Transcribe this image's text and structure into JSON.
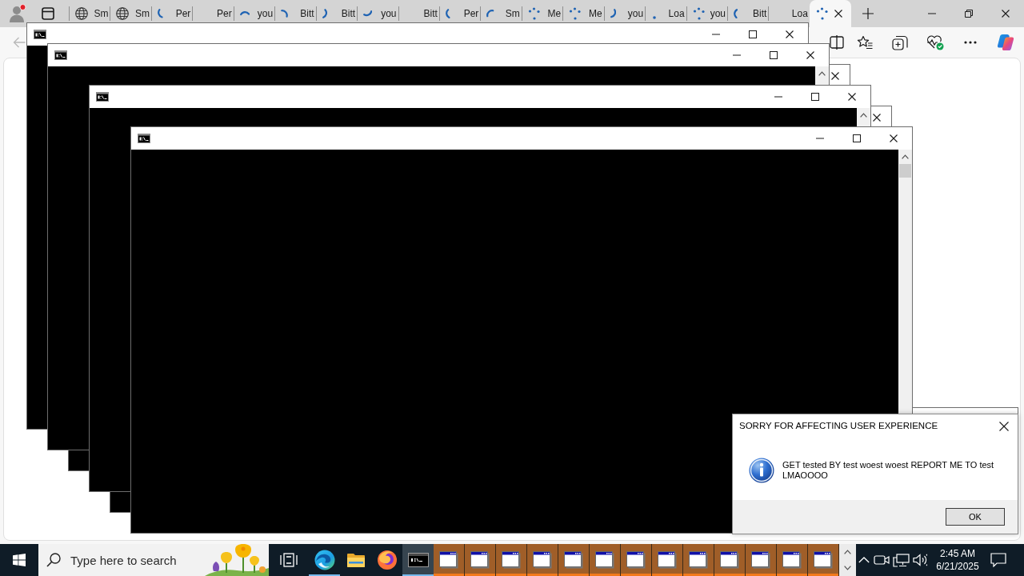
{
  "browser": {
    "tabs": [
      {
        "label": "Sm",
        "kind": "globe",
        "selected": false
      },
      {
        "label": "Sm",
        "kind": "globe",
        "selected": false
      },
      {
        "label": "Per",
        "kind": "spinner",
        "selected": false
      },
      {
        "label": "Per",
        "kind": "plain",
        "selected": false
      },
      {
        "label": "you",
        "kind": "spinner",
        "selected": false
      },
      {
        "label": "Bitt",
        "kind": "spinner",
        "selected": false
      },
      {
        "label": "Bitt",
        "kind": "spinner",
        "selected": false
      },
      {
        "label": "you",
        "kind": "spinner",
        "selected": false
      },
      {
        "label": "Bitt",
        "kind": "plain",
        "selected": false
      },
      {
        "label": "Per",
        "kind": "spinner",
        "selected": false
      },
      {
        "label": "Sm",
        "kind": "spinner",
        "selected": false
      },
      {
        "label": "Me",
        "kind": "dots",
        "selected": false
      },
      {
        "label": "Me",
        "kind": "dots",
        "selected": false
      },
      {
        "label": "you",
        "kind": "spinner",
        "selected": false
      },
      {
        "label": "Loa",
        "kind": "dot",
        "selected": false
      },
      {
        "label": "you",
        "kind": "dots",
        "selected": false
      },
      {
        "label": "Bitt",
        "kind": "spinner",
        "selected": false
      },
      {
        "label": "Loa",
        "kind": "plain",
        "selected": false
      },
      {
        "kind": "dots",
        "selected": true
      }
    ],
    "back": {
      "disabled": true
    }
  },
  "windows": [
    {
      "kind": "console"
    },
    {
      "kind": "console"
    },
    {
      "kind": "console"
    },
    {
      "kind": "console"
    },
    {
      "kind": "console"
    },
    {
      "kind": "console"
    },
    {
      "kind": "frame"
    }
  ],
  "dialog": {
    "title": "SORRY FOR AFFECTING USER EXPERIENCE",
    "message": "GET tested BY test woest woest REPORT ME TO test LMAOOOO",
    "button": "OK"
  },
  "taskbar": {
    "search": {
      "placeholder": "Type here to search"
    },
    "apps": [
      {
        "kind": "browser",
        "selected": false,
        "running": true
      },
      {
        "kind": "folder",
        "selected": false,
        "running": false
      },
      {
        "kind": "fox",
        "selected": false,
        "running": false
      },
      {
        "kind": "console",
        "selected": true,
        "running": true
      }
    ],
    "windows": [
      {
        "flashing": true
      },
      {
        "flashing": true
      },
      {
        "flashing": true
      },
      {
        "flashing": true
      },
      {
        "flashing": true
      },
      {
        "flashing": true
      },
      {
        "flashing": true
      },
      {
        "flashing": true
      },
      {
        "flashing": true
      },
      {
        "flashing": true
      },
      {
        "flashing": true
      },
      {
        "flashing": true
      },
      {
        "flashing": true
      }
    ],
    "clock": {
      "time": "2:45 AM",
      "date": "6/21/2025"
    }
  }
}
